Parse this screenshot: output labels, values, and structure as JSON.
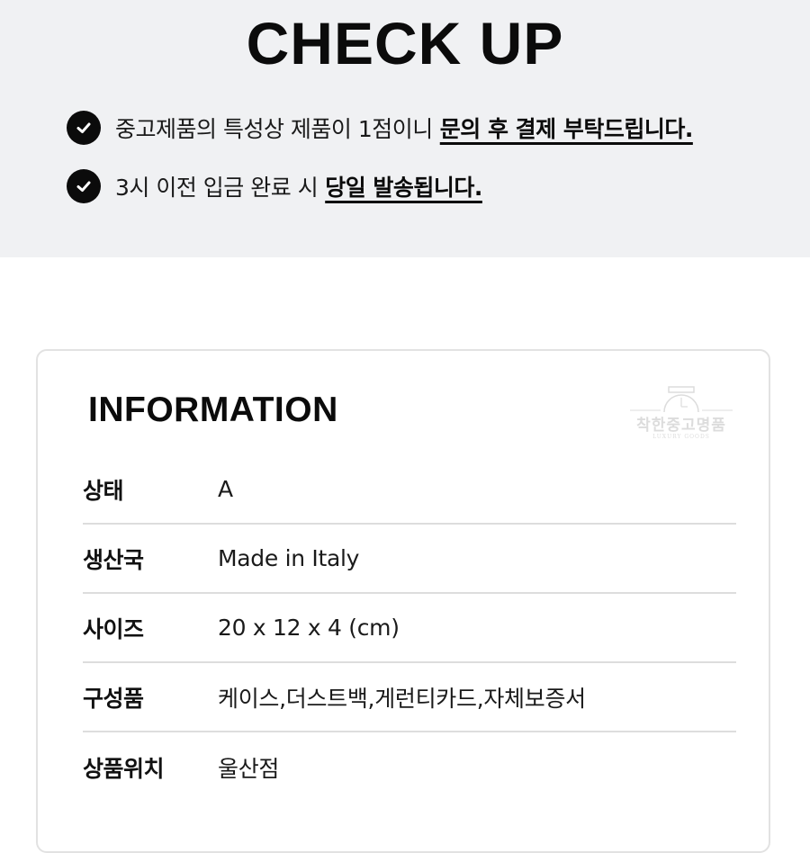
{
  "header": {
    "title": "CHECK UP",
    "notices": [
      {
        "icon": "check-circle-icon",
        "text": "중고제품의 특성상 제품이 1점이니",
        "emphasis": "문의 후 결제 부탁드립니다."
      },
      {
        "icon": "check-circle-icon",
        "text": "3시 이전 입금 완료 시",
        "emphasis": "당일 발송됩니다."
      }
    ]
  },
  "information": {
    "title": "INFORMATION",
    "watermark": {
      "icon": "watch-icon",
      "text": "착한중고명품",
      "subtext": "LUXURY GOODS"
    },
    "rows": [
      {
        "label": "상태",
        "value": "A"
      },
      {
        "label": "생산국",
        "value": "Made in Italy"
      },
      {
        "label": "사이즈",
        "value": "20 x 12 x 4 (cm)"
      },
      {
        "label": "구성품",
        "value": "케이스,더스트백,게런티카드,자체보증서"
      },
      {
        "label": "상품위치",
        "value": "울산점"
      }
    ]
  },
  "colors": {
    "header_background": "#f0f1f3",
    "text": "#111111",
    "divider": "#dddddd",
    "card_border": "#e2e2e2"
  }
}
